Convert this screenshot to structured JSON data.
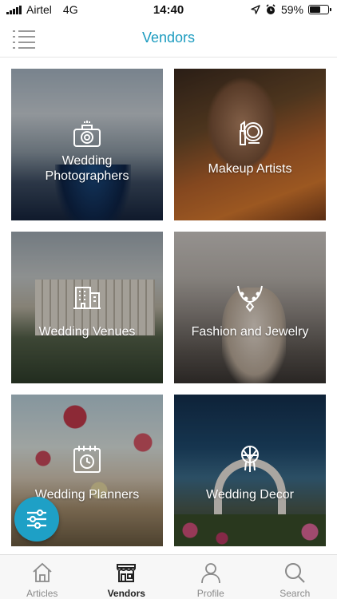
{
  "status_bar": {
    "carrier": "Airtel",
    "network": "4G",
    "time": "14:40",
    "battery_percent": "59%",
    "battery_level": 0.59
  },
  "header": {
    "title": "Vendors",
    "menu_icon": "list-menu-icon"
  },
  "categories": [
    {
      "label": "Wedding\nPhotographers",
      "icon": "camera-icon"
    },
    {
      "label": "Makeup Artists",
      "icon": "makeup-icon"
    },
    {
      "label": "Wedding Venues",
      "icon": "building-icon"
    },
    {
      "label": "Fashion and Jewelry",
      "icon": "necklace-icon"
    },
    {
      "label": "Wedding Planners",
      "icon": "calendar-clock-icon"
    },
    {
      "label": "Wedding Decor",
      "icon": "dreamcatcher-icon"
    }
  ],
  "fab": {
    "icon": "filter-sliders-icon"
  },
  "bottom_nav": [
    {
      "label": "Articles",
      "icon": "home-icon",
      "active": false
    },
    {
      "label": "Vendors",
      "icon": "store-icon",
      "active": true
    },
    {
      "label": "Profile",
      "icon": "user-icon",
      "active": false
    },
    {
      "label": "Search",
      "icon": "search-icon",
      "active": false
    }
  ],
  "colors": {
    "accent": "#1b9bbf",
    "fab": "#1ea0c6",
    "nav_inactive": "#8a8a8a",
    "nav_active": "#222222"
  }
}
